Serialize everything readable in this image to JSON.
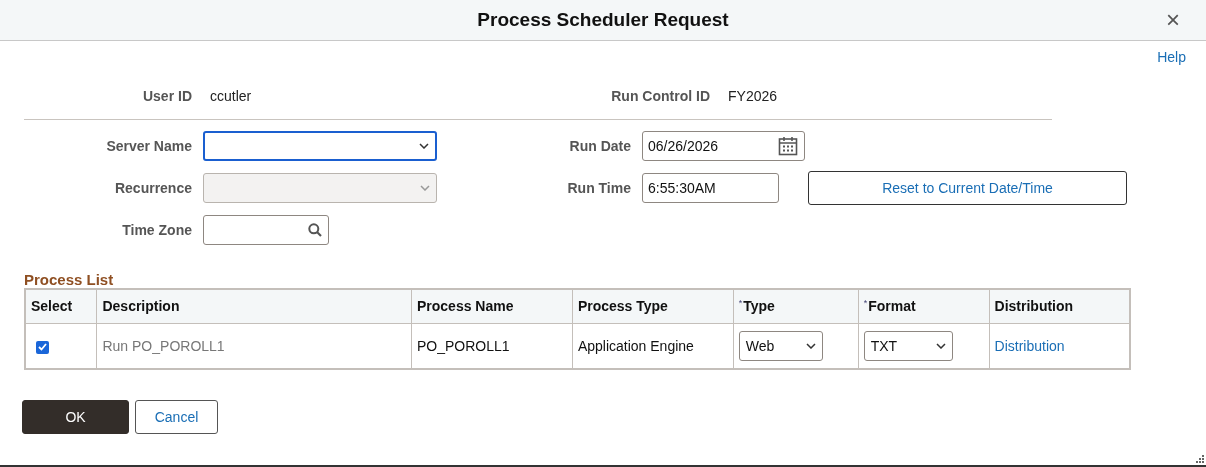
{
  "window": {
    "title": "Process Scheduler Request",
    "close": "×"
  },
  "help_link": "Help",
  "header_fields": [
    {
      "label": "User ID",
      "value": "ccutler"
    },
    {
      "label": "Run Control ID",
      "value": "FY2026"
    }
  ],
  "form": {
    "server_name": {
      "label": "Server Name",
      "focused": true,
      "disabled": false
    },
    "recurrence": {
      "label": "Recurrence",
      "focused": false,
      "disabled": true
    },
    "time_zone": {
      "label": "Time Zone"
    },
    "run_date": {
      "label": "Run Date",
      "value": "06/26/2026"
    },
    "run_time": {
      "label": "Run Time",
      "value": "6:55:30AM"
    },
    "reset_button": "Reset to Current Date/Time"
  },
  "process_list": {
    "title": "Process List",
    "columns": [
      {
        "label": "Select"
      },
      {
        "label": "Description"
      },
      {
        "label": "Process Name"
      },
      {
        "label": "Process Type"
      },
      {
        "label": "Type",
        "marker": "*"
      },
      {
        "label": "Format",
        "marker": "*"
      },
      {
        "label": "Distribution"
      }
    ],
    "rows": [
      {
        "checked": true,
        "description": "Run PO_POROLL1",
        "process_name": "PO_POROLL1",
        "process_type": "Application Engine",
        "type": "Web",
        "format": "TXT",
        "distribution": "Distribution"
      }
    ]
  },
  "buttons": [
    {
      "label": "OK",
      "kind": "primary"
    },
    {
      "label": "Cancel",
      "kind": "secondary"
    }
  ]
}
